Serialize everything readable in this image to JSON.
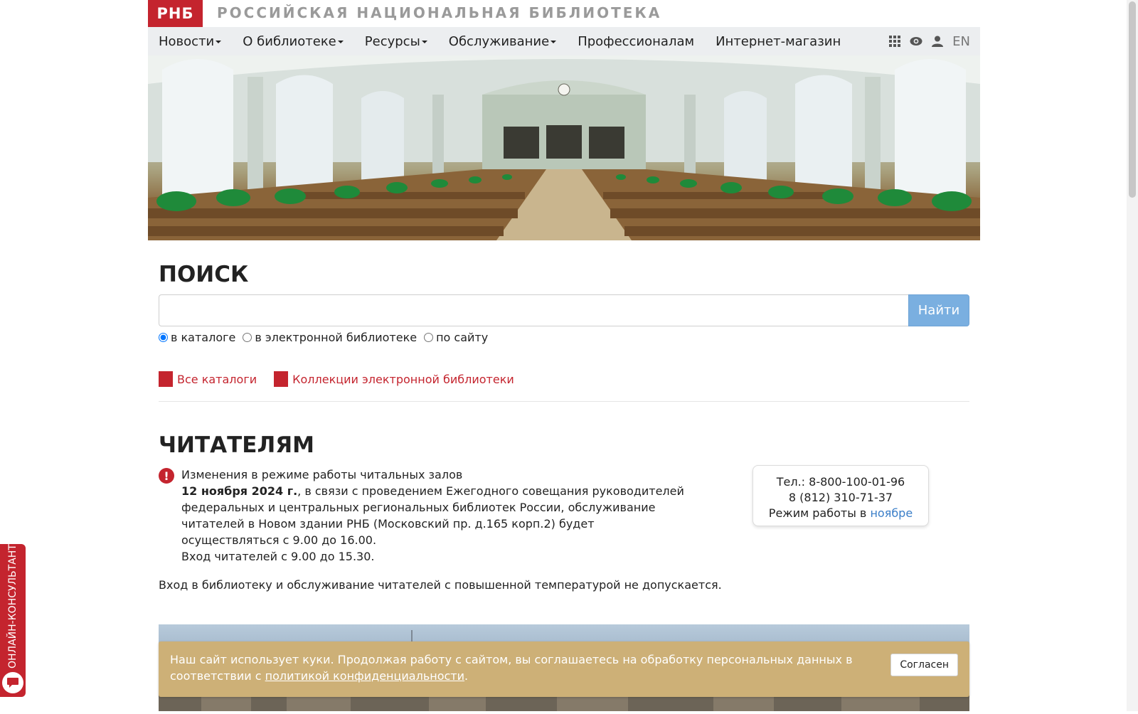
{
  "brand": {
    "logo": "РНБ",
    "title": "РОССИЙСКАЯ НАЦИОНАЛЬНАЯ БИБЛИОТЕКА"
  },
  "nav": {
    "items": [
      {
        "label": "Новости",
        "dropdown": true
      },
      {
        "label": "О библиотеке",
        "dropdown": true
      },
      {
        "label": "Ресурсы",
        "dropdown": true
      },
      {
        "label": "Обслуживание",
        "dropdown": true
      },
      {
        "label": "Профессионалам",
        "dropdown": false
      },
      {
        "label": "Интернет-магазин",
        "dropdown": false
      }
    ],
    "tools": [
      "grid-icon",
      "eye-icon",
      "user-icon"
    ],
    "lang": "EN"
  },
  "search": {
    "title": "ПОИСК",
    "value": "",
    "button": "Найти",
    "options": [
      "в каталоге",
      "в электронной библиотеке",
      "по сайту"
    ],
    "selected": "в каталоге"
  },
  "links": {
    "catalogs": "Все каталоги",
    "collections": "Коллекции электронной библиотеки"
  },
  "readers": {
    "title": "ЧИТАТЕЛЯМ",
    "notice_title": "Изменения в режиме работы читальных залов",
    "notice_date": "12 ноября 2024 г.",
    "notice_body": ", в связи с проведением Ежегодного совещания руководителей федеральных и центральных региональных библиотек России, обслуживание читателей в Новом здании РНБ (Московский пр. д.165 корп.2) будет осуществляться с 9.00 до 16.00.",
    "notice_entry": "Вход читателей с 9.00 до 15.30.",
    "temperature": "Вход в библиотеку и обслуживание читателей с повышенной температурой не допускается."
  },
  "contact": {
    "phone1": "Тел.: 8-800-100-01-96",
    "phone2": "8 (812) 310-71-37",
    "hours_prefix": "Режим работы в ",
    "hours_link": "ноябре"
  },
  "cookie": {
    "text": "Наш сайт использует куки. Продолжая работу с сайтом, вы соглашаетесь на обработку персональных данных в соответствии с ",
    "link": "политикой конфиденциальности",
    "end": ".",
    "button": "Согласен"
  },
  "consultant": {
    "label": "ОНЛАЙН-КОНСУЛЬТАНТ"
  },
  "colors": {
    "accent": "#c4242e",
    "button": "#7aafe0",
    "link": "#3a7ec8",
    "cookie": "#cdb077"
  }
}
